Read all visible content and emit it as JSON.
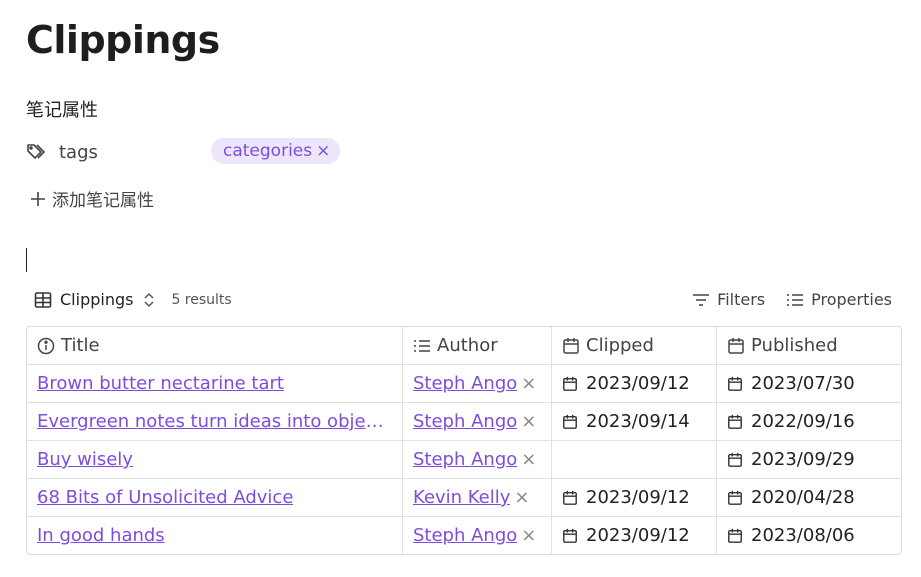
{
  "page": {
    "title": "Clippings"
  },
  "properties": {
    "section_label": "笔记属性",
    "tags": {
      "name": "tags",
      "values": [
        "categories"
      ],
      "remove_glyph": "×"
    },
    "add_label": "添加笔记属性"
  },
  "view": {
    "name": "Clippings",
    "results": "5 results",
    "filters_label": "Filters",
    "properties_label": "Properties"
  },
  "table": {
    "columns": [
      {
        "label": "Title",
        "icon": "info-icon"
      },
      {
        "label": "Author",
        "icon": "list-icon"
      },
      {
        "label": "Clipped",
        "icon": "calendar-icon"
      },
      {
        "label": "Published",
        "icon": "calendar-icon"
      }
    ],
    "rows": [
      {
        "title": "Brown butter nectarine tart",
        "author": "Steph Ango",
        "clipped": "2023/09/12",
        "published": "2023/07/30"
      },
      {
        "title": "Evergreen notes turn ideas into objects t…",
        "author": "Steph Ango",
        "clipped": "2023/09/14",
        "published": "2022/09/16"
      },
      {
        "title": "Buy wisely",
        "author": "Steph Ango",
        "clipped": "",
        "published": "2023/09/29"
      },
      {
        "title": "68 Bits of Unsolicited Advice",
        "author": "Kevin Kelly",
        "clipped": "2023/09/12",
        "published": "2020/04/28"
      },
      {
        "title": "In good hands",
        "author": "Steph Ango",
        "clipped": "2023/09/12",
        "published": "2023/08/06"
      }
    ],
    "author_remove_glyph": "×"
  },
  "colors": {
    "accent": "#7c4ddd",
    "tag_bg": "#ede6fb",
    "border": "#e2e2e2"
  }
}
